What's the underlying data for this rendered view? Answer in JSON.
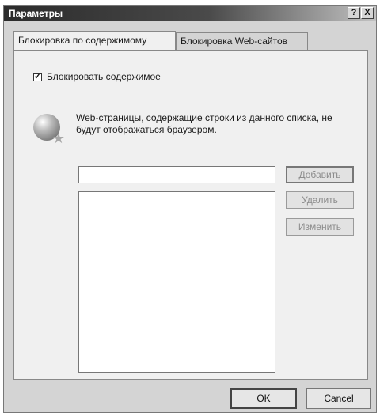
{
  "window": {
    "title": "Параметры",
    "help_glyph": "?",
    "close_glyph": "X"
  },
  "tabs": [
    {
      "label": "Блокировка по содержимому",
      "active": true
    },
    {
      "label": "Блокировка Web-сайтов",
      "active": false
    }
  ],
  "content": {
    "checkbox_label": "Блокировать содержимое",
    "checkbox_checked": true,
    "description": "Web-страницы, содержащие строки из данного списка, не будут отображаться браузером.",
    "input_value": "",
    "list_items": []
  },
  "buttons": {
    "add": "Добавить",
    "remove": "Удалить",
    "edit": "Изменить"
  },
  "footer": {
    "ok": "OK",
    "cancel": "Cancel"
  },
  "icons": {
    "info": "globe-star-icon"
  }
}
